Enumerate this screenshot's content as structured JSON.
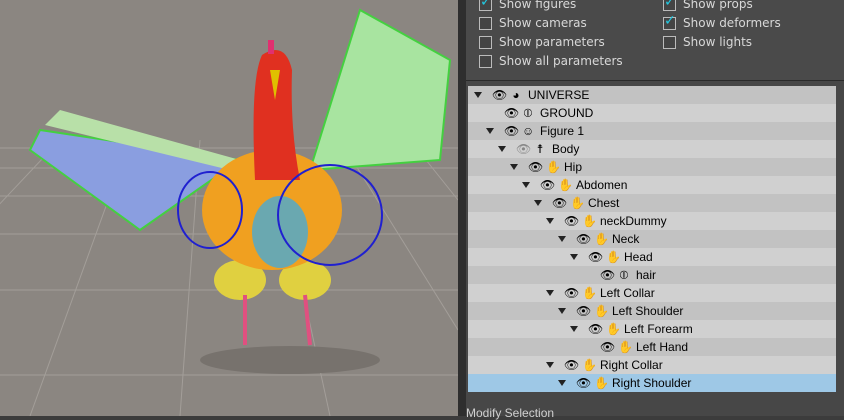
{
  "options": {
    "show_figures": {
      "label": "Show figures",
      "checked": true
    },
    "show_props": {
      "label": "Show props",
      "checked": true
    },
    "show_cameras": {
      "label": "Show cameras",
      "checked": false
    },
    "show_deformers": {
      "label": "Show deformers",
      "checked": true
    },
    "show_parameters": {
      "label": "Show parameters",
      "checked": false
    },
    "show_lights": {
      "label": "Show lights",
      "checked": false
    },
    "show_all_parameters": {
      "label": "Show all parameters",
      "checked": false
    }
  },
  "tree": [
    {
      "label": "UNIVERSE",
      "depth": 0,
      "expandable": true,
      "icon": "globe-icon"
    },
    {
      "label": "GROUND",
      "depth": 1,
      "expandable": false,
      "icon": "prop-icon"
    },
    {
      "label": "Figure 1",
      "depth": 1,
      "expandable": true,
      "icon": "figure-icon"
    },
    {
      "label": "Body",
      "depth": 2,
      "expandable": true,
      "icon": "body-icon",
      "hidden": true
    },
    {
      "label": "Hip",
      "depth": 3,
      "expandable": true,
      "icon": "hand-icon"
    },
    {
      "label": "Abdomen",
      "depth": 4,
      "expandable": true,
      "icon": "hand-icon"
    },
    {
      "label": "Chest",
      "depth": 5,
      "expandable": true,
      "icon": "hand-icon"
    },
    {
      "label": "neckDummy",
      "depth": 6,
      "expandable": true,
      "icon": "hand-icon"
    },
    {
      "label": "Neck",
      "depth": 7,
      "expandable": true,
      "icon": "hand-icon"
    },
    {
      "label": "Head",
      "depth": 8,
      "expandable": true,
      "icon": "hand-icon"
    },
    {
      "label": "hair",
      "depth": 9,
      "expandable": false,
      "icon": "prop-icon"
    },
    {
      "label": "Left Collar",
      "depth": 6,
      "expandable": true,
      "icon": "hand-icon"
    },
    {
      "label": "Left Shoulder",
      "depth": 7,
      "expandable": true,
      "icon": "hand-icon"
    },
    {
      "label": "Left Forearm",
      "depth": 8,
      "expandable": true,
      "icon": "hand-icon"
    },
    {
      "label": "Left Hand",
      "depth": 9,
      "expandable": false,
      "icon": "hand-icon"
    },
    {
      "label": "Right Collar",
      "depth": 6,
      "expandable": true,
      "icon": "hand-icon"
    },
    {
      "label": "Right Shoulder",
      "depth": 7,
      "expandable": true,
      "icon": "hand-icon",
      "selected": true
    }
  ],
  "section_label": "Modify Selection",
  "colors": {
    "selection": "#9ec8e6",
    "check": "#22c8e0"
  }
}
